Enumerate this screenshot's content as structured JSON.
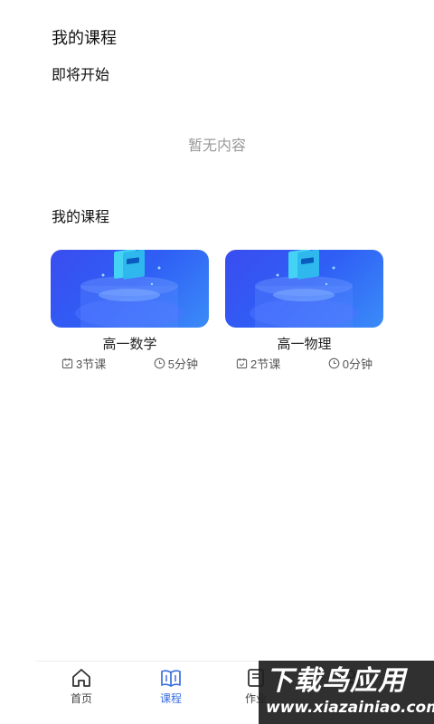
{
  "header": {
    "title": "我的课程"
  },
  "upcoming": {
    "title": "即将开始",
    "empty_text": "暂无内容"
  },
  "courses": {
    "title": "我的课程",
    "items": [
      {
        "name": "高一数学",
        "lessons": "3节课",
        "duration": "5分钟"
      },
      {
        "name": "高一物理",
        "lessons": "2节课",
        "duration": "0分钟"
      }
    ]
  },
  "tabbar": {
    "items": [
      {
        "label": "首页",
        "icon": "home-icon"
      },
      {
        "label": "课程",
        "icon": "book-open-icon",
        "active": true
      },
      {
        "label": "作业",
        "icon": "homework-icon"
      },
      {
        "label": "",
        "icon": "profile-icon"
      }
    ]
  },
  "watermark": {
    "main": "下载鸟应用",
    "url": "www.xiazainiao.com"
  },
  "colors": {
    "accent": "#3a6fe0",
    "cover_start": "#3a4df0",
    "cover_end": "#3b8cf8"
  }
}
